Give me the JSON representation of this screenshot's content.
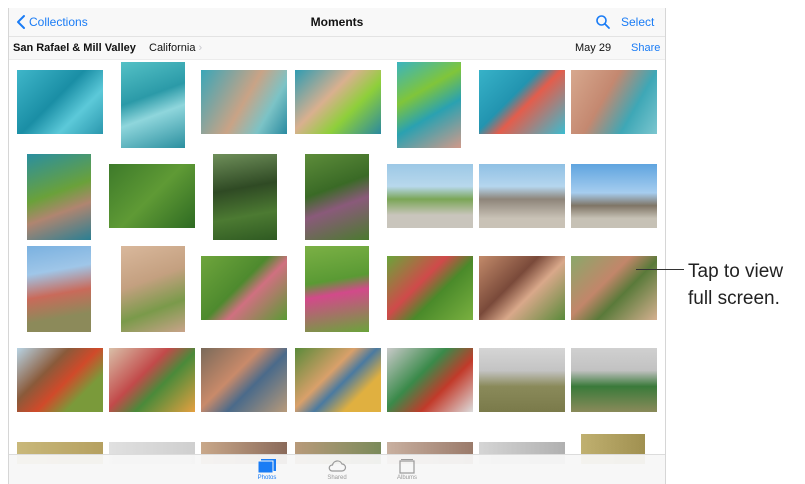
{
  "navbar": {
    "back_label": "Collections",
    "title": "Moments",
    "select_label": "Select",
    "search_icon": "search-icon",
    "back_icon": "chevron-left-icon"
  },
  "subbar": {
    "place": "San Rafael & Mill Valley",
    "region": "California",
    "date": "May 29",
    "share_label": "Share"
  },
  "tabbar": {
    "tabs": [
      {
        "label": "Photos",
        "icon": "photos-icon",
        "active": true
      },
      {
        "label": "Shared",
        "icon": "cloud-icon",
        "active": false
      },
      {
        "label": "Albums",
        "icon": "albums-icon",
        "active": false
      }
    ]
  },
  "callout": {
    "text": "Tap to view full screen."
  },
  "colors": {
    "accent": "#1a7cf5"
  }
}
